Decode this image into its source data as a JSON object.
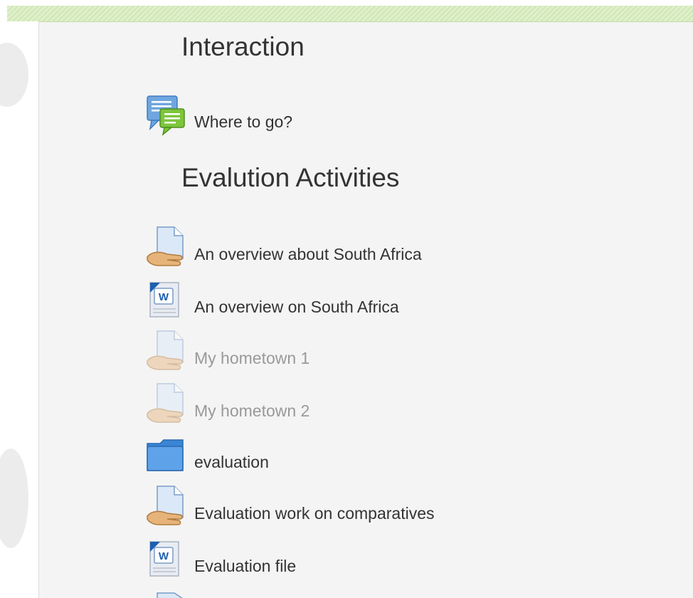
{
  "sections": [
    {
      "title": "Interaction",
      "activities": [
        {
          "label": "Where to go?",
          "icon": "forum-icon",
          "dimmed": false
        }
      ]
    },
    {
      "title": "Evalution Activities",
      "activities": [
        {
          "label": "An overview about South Africa",
          "icon": "assignment-icon",
          "dimmed": false
        },
        {
          "label": "An overview on South Africa",
          "icon": "word-document-icon",
          "dimmed": false
        },
        {
          "label": "My hometown 1",
          "icon": "assignment-icon",
          "dimmed": true
        },
        {
          "label": "My hometown 2",
          "icon": "assignment-icon",
          "dimmed": true
        },
        {
          "label": "evaluation",
          "icon": "folder-icon",
          "dimmed": false
        },
        {
          "label": "Evaluation work on comparatives",
          "icon": "assignment-icon",
          "dimmed": false
        },
        {
          "label": "Evaluation file",
          "icon": "word-document-icon",
          "dimmed": false
        }
      ]
    }
  ],
  "colors": {
    "header_band": "#d4eabf",
    "content_bg": "#f4f4f4",
    "text": "#333333",
    "dimmed_text": "#999999"
  }
}
